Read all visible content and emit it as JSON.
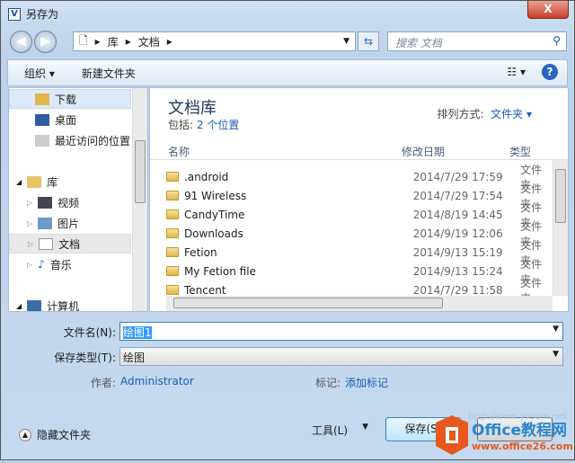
{
  "window": {
    "title": "另存为",
    "close_label": "X"
  },
  "address": {
    "path": [
      "库",
      "文档"
    ],
    "search_placeholder": "搜索 文档"
  },
  "toolbar": {
    "organize": "组织 ▾",
    "new_folder": "新建文件夹",
    "view": "☷ ▾",
    "help": "?"
  },
  "sidebar": {
    "items": [
      {
        "label": "下载",
        "icon": "download-folder-icon"
      },
      {
        "label": "桌面",
        "icon": "desktop-icon"
      },
      {
        "label": "最近访问的位置",
        "icon": "recent-places-icon"
      },
      {
        "label": "库",
        "icon": "library-icon"
      },
      {
        "label": "视频",
        "icon": "video-icon"
      },
      {
        "label": "图片",
        "icon": "picture-icon"
      },
      {
        "label": "文档",
        "icon": "document-icon",
        "selected": true
      },
      {
        "label": "音乐",
        "icon": "music-icon"
      },
      {
        "label": "计算机",
        "icon": "computer-icon"
      }
    ]
  },
  "library": {
    "title": "文档库",
    "includes_prefix": "包括:",
    "includes_link": "2 个位置",
    "arrange_label": "排列方式:",
    "arrange_value": "文件夹 ▾"
  },
  "columns": [
    "名称",
    "修改日期",
    "类型"
  ],
  "files": [
    {
      "name": ".android",
      "date": "2014/7/29 17:59",
      "type": "文件夹"
    },
    {
      "name": "91 Wireless",
      "date": "2014/7/29 17:54",
      "type": "文件夹"
    },
    {
      "name": "CandyTime",
      "date": "2014/8/19 14:45",
      "type": "文件夹"
    },
    {
      "name": "Downloads",
      "date": "2014/9/19 12:06",
      "type": "文件夹"
    },
    {
      "name": "Fetion",
      "date": "2014/9/13 15:19",
      "type": "文件夹"
    },
    {
      "name": "My Fetion file",
      "date": "2014/9/13 15:24",
      "type": "文件夹"
    },
    {
      "name": "Tencent",
      "date": "2014/7/29 11:58",
      "type": "文件夹"
    }
  ],
  "form": {
    "filename_label": "文件名(N):",
    "filename_value": "绘图1",
    "type_label": "保存类型(T):",
    "type_value": "绘图",
    "author_label": "作者:",
    "author_value": "Administrator",
    "tags_label": "标记:",
    "tags_value": "添加标记"
  },
  "footer": {
    "hide_folders": "隐藏文件夹",
    "tools": "工具(L)",
    "save": "保存(S)"
  },
  "watermark": {
    "url": "http://www.yvsom.net",
    "brand": "Office教程网",
    "site": "www.office26.com"
  }
}
